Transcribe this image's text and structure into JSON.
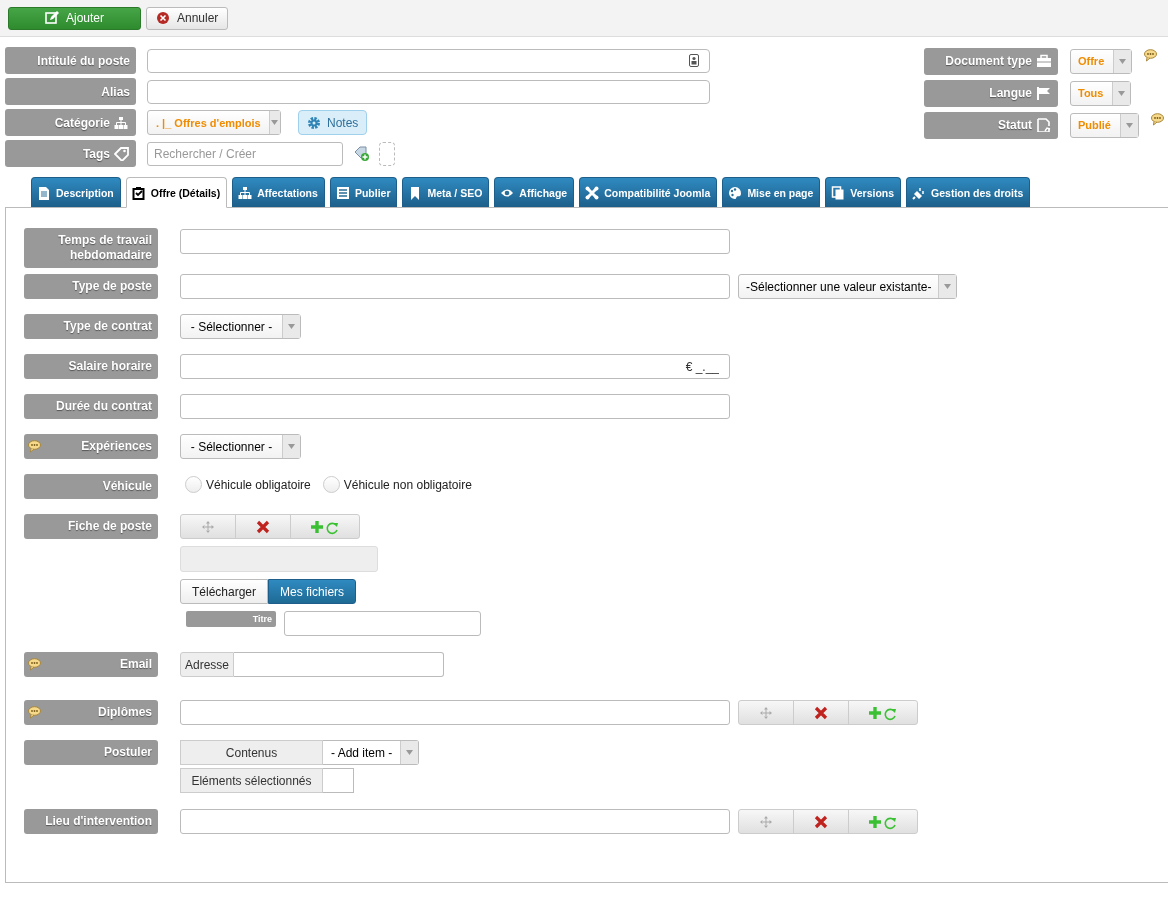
{
  "toolbar": {
    "buttons": [
      {
        "label": "Ajouter",
        "kind": "save"
      },
      {
        "label": "Annuler",
        "kind": "cancel"
      }
    ]
  },
  "header": {
    "left": [
      {
        "label": "Intitulé du poste",
        "kind": "text"
      },
      {
        "label": "Alias",
        "kind": "text"
      },
      {
        "label": "Catégorie",
        "kind": "category",
        "value": ". |_ Offres d'emplois",
        "button": "Notes"
      },
      {
        "label": "Tags",
        "kind": "tags",
        "placeholder": "Rechercher / Créer"
      }
    ],
    "right": [
      {
        "label": "Document type",
        "value": "Offre",
        "tip": true
      },
      {
        "label": "Langue",
        "value": "Tous",
        "tip": false
      },
      {
        "label": "Statut",
        "value": "Publié",
        "tip": true
      }
    ]
  },
  "tabs": [
    {
      "label": "Description",
      "selected": false
    },
    {
      "label": "Offre (Détails)",
      "selected": true
    },
    {
      "label": "Affectations",
      "selected": false
    },
    {
      "label": "Publier",
      "selected": false
    },
    {
      "label": "Meta / SEO",
      "selected": false
    },
    {
      "label": "Affichage",
      "selected": false
    },
    {
      "label": "Compatibilité Joomla",
      "selected": false
    },
    {
      "label": "Mise en page",
      "selected": false
    },
    {
      "label": "Versions",
      "selected": false
    },
    {
      "label": "Gestion des droits",
      "selected": false
    }
  ],
  "fields": [
    {
      "label": "Temps de travail hebdomadaire",
      "kind": "text",
      "tip": false
    },
    {
      "label": "Type de poste",
      "kind": "text_select",
      "tip": false,
      "select": "-Sélectionner une valeur existante-"
    },
    {
      "label": "Type de contrat",
      "kind": "select",
      "tip": false,
      "select": "- Sélectionner -"
    },
    {
      "label": "Salaire horaire",
      "kind": "money",
      "tip": false,
      "value": "€ _.__"
    },
    {
      "label": "Durée du contrat",
      "kind": "text",
      "tip": false
    },
    {
      "label": "Expériences",
      "kind": "select",
      "tip": true,
      "select": "- Sélectionner -"
    },
    {
      "label": "Véhicule",
      "kind": "radio",
      "tip": false,
      "options": [
        {
          "label": "Véhicule obligatoire",
          "selected": false
        },
        {
          "label": "Véhicule non obligatoire",
          "selected": false
        }
      ]
    },
    {
      "label": "Fiche de poste",
      "kind": "file",
      "tip": false,
      "sources": [
        {
          "label": "Télécharger",
          "selected": false
        },
        {
          "label": "Mes fichiers",
          "selected": true
        }
      ],
      "title_label": "Titre"
    },
    {
      "label": "Email",
      "kind": "email",
      "tip": true,
      "addon": "Adresse"
    },
    {
      "label": "Diplômes",
      "kind": "repeat",
      "tip": true
    },
    {
      "label": "Postuler",
      "kind": "postuler",
      "tip": false,
      "content_label": "Contenus",
      "select": "- Add item -",
      "selected_label": "Eléments sélectionnés"
    },
    {
      "label": "Lieu d'intervention",
      "kind": "repeat",
      "tip": false
    }
  ]
}
